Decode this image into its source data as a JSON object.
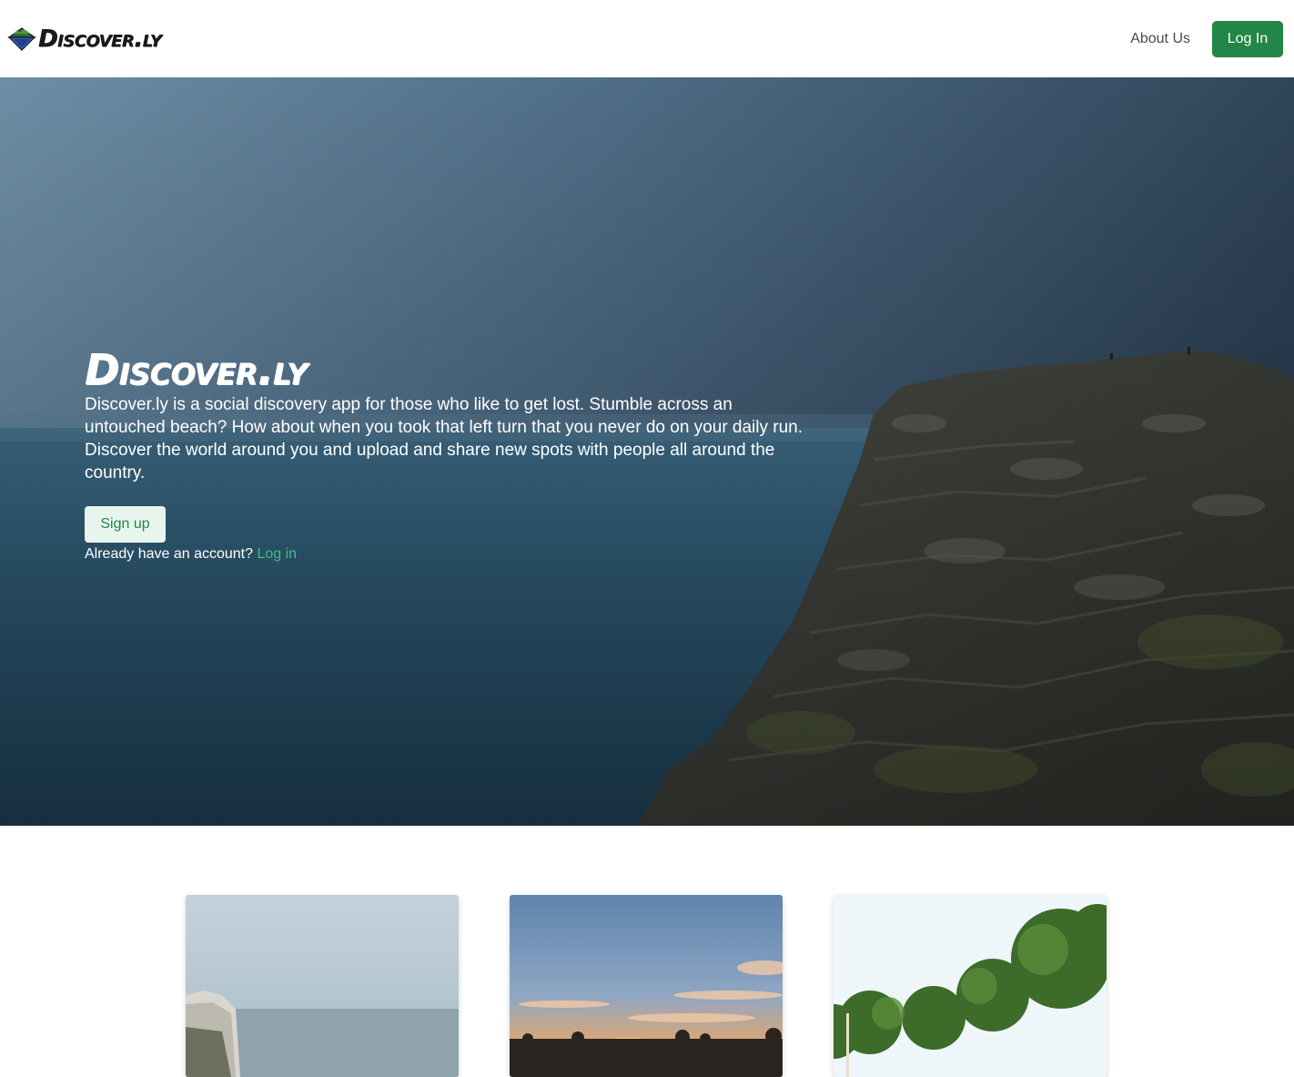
{
  "navbar": {
    "brand": "Discover.ly",
    "logo_icon": "mountain-lake-logo-icon",
    "about_label": "About Us",
    "login_label": "Log In",
    "accent_color": "#218646"
  },
  "hero": {
    "title": "Discover.ly",
    "description": "Discover.ly is a social discovery app for those who like to get lost. Stumble across an untouched beach? How about when you took that left turn that you never do on your daily run. Discover the world around you and upload and share new spots with people all around the country.",
    "signup_label": "Sign up",
    "already_text": "Already have an account?",
    "login_link_label": "Log in",
    "background": "sea-cliff-photo"
  },
  "cards": [
    {
      "image": "foggy-cliff-coast-photo"
    },
    {
      "image": "sunset-sky-photo"
    },
    {
      "image": "green-trees-photo"
    }
  ]
}
